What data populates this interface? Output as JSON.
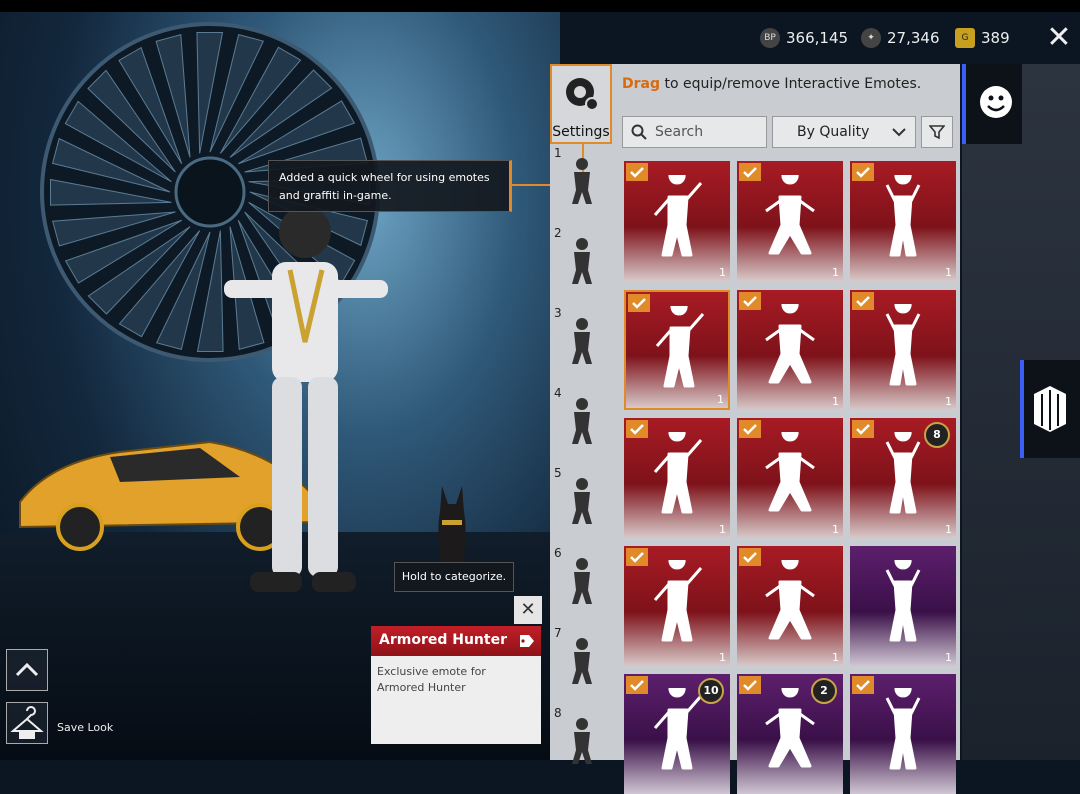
{
  "currencies": [
    {
      "icon": "bp-coin-icon",
      "symbol": "BP",
      "value": "366,145"
    },
    {
      "icon": "silver-fragment-icon",
      "symbol": "",
      "value": "27,346"
    },
    {
      "icon": "uc-coin-icon",
      "symbol": "G",
      "value": "389"
    }
  ],
  "close_label": "✕",
  "panel": {
    "settings_label": "Settings",
    "drag_hint_keyword": "Drag",
    "drag_hint_rest": " to equip/remove Interactive Emotes.",
    "search_placeholder": "Search",
    "sort_label": "By Quality"
  },
  "slots": [
    "1",
    "2",
    "3",
    "4",
    "5",
    "6",
    "7",
    "8"
  ],
  "emotes": [
    {
      "count": "1",
      "color": "red",
      "checked": true,
      "badge": ""
    },
    {
      "count": "1",
      "color": "red",
      "checked": true,
      "badge": ""
    },
    {
      "count": "1",
      "color": "red",
      "checked": true,
      "badge": ""
    },
    {
      "count": "1",
      "color": "red",
      "checked": true,
      "badge": "",
      "selected": true
    },
    {
      "count": "1",
      "color": "red",
      "checked": true,
      "badge": ""
    },
    {
      "count": "1",
      "color": "red",
      "checked": true,
      "badge": ""
    },
    {
      "count": "1",
      "color": "red",
      "checked": true,
      "badge": ""
    },
    {
      "count": "1",
      "color": "red",
      "checked": true,
      "badge": ""
    },
    {
      "count": "1",
      "color": "red",
      "checked": true,
      "badge": "8"
    },
    {
      "count": "1",
      "color": "red",
      "checked": true,
      "badge": ""
    },
    {
      "count": "1",
      "color": "red",
      "checked": true,
      "badge": ""
    },
    {
      "count": "1",
      "color": "purple",
      "checked": false,
      "badge": ""
    },
    {
      "count": "",
      "color": "purple",
      "checked": true,
      "badge": "10"
    },
    {
      "count": "",
      "color": "purple",
      "checked": true,
      "badge": "2"
    },
    {
      "count": "",
      "color": "purple",
      "checked": true,
      "badge": ""
    }
  ],
  "tooltips": {
    "wheel_line1": "Added a quick wheel for using emotes",
    "wheel_line2": "and graffiti in-game.",
    "hold": "Hold to categorize."
  },
  "info_card": {
    "title": "Armored Hunter",
    "description": "Exclusive emote for Armored Hunter",
    "close_label": "✕"
  },
  "left": {
    "save_look_label": "Save Look"
  },
  "colors": {
    "accent": "#e08a2a",
    "rail_active": "#3b5ef5",
    "card_red": "#a81b24",
    "card_purple": "#5d1f6d"
  }
}
